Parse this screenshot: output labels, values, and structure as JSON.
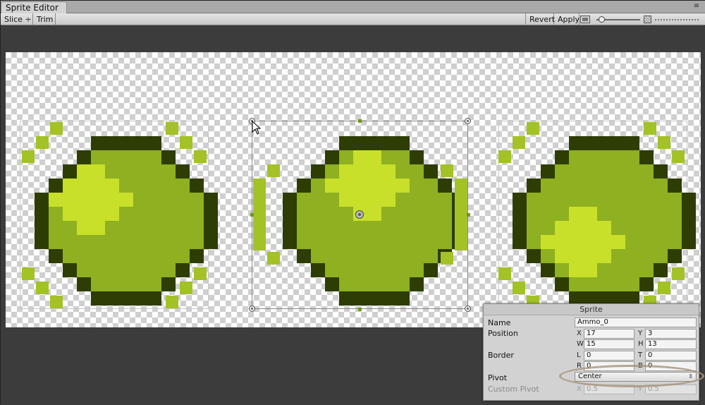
{
  "window": {
    "tab_title": "Sprite Editor",
    "menu_icon": "menu-icon"
  },
  "toolbar": {
    "slice_label": "Slice ÷",
    "trim_label": "Trim",
    "revert_label": "Revert",
    "apply_label": "Apply",
    "zoom_level": 0.05
  },
  "colors": {
    "dark_green": "#2e3d04",
    "mid_green": "#8fb020",
    "light_green": "#c8e02a",
    "accent_green": "#a2c226",
    "panel_bg": "#d2d2d2",
    "canvas_bg": "#3c3c3c"
  },
  "inspector": {
    "title": "Sprite",
    "name_label": "Name",
    "name_value": "Ammo_0",
    "position_label": "Position",
    "x_label": "X",
    "x_value": "17",
    "y_label": "Y",
    "y_value": "3",
    "w_label": "W",
    "w_value": "15",
    "h_label": "H",
    "h_value": "13",
    "border_label": "Border",
    "l_label": "L",
    "l_value": "0",
    "t_label": "T",
    "t_value": "0",
    "r_label": "R",
    "r_value": "0",
    "b_label": "B",
    "b_value": "0",
    "pivot_label": "Pivot",
    "pivot_value": "Center",
    "custom_pivot_label": "Custom Pivot",
    "cx_label": "X",
    "cx_value": "0.5",
    "cy_label": "Y",
    "cy_value": "0.5"
  }
}
